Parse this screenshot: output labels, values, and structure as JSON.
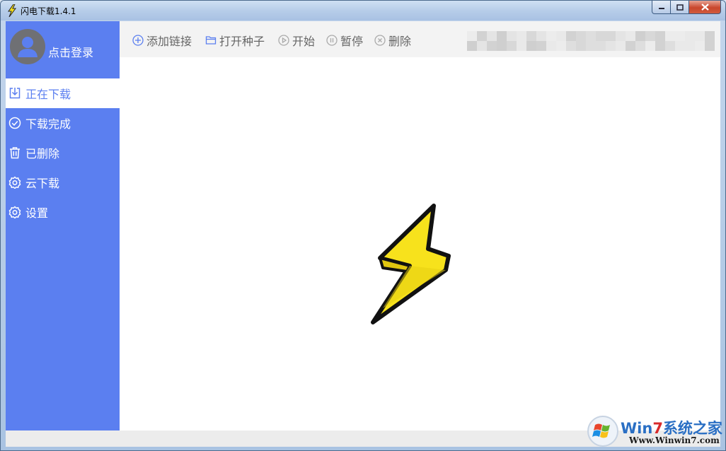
{
  "window": {
    "title": "闪电下载1.4.1",
    "icon": "lightning-bolt-icon",
    "controls": {
      "minimize": "minimize-icon",
      "maximize": "maximize-icon",
      "close": "close-icon"
    }
  },
  "colors": {
    "sidebar": "#5b7ff0",
    "active_text": "#5b7ff0",
    "toolbar_bg": "#f3f3f3",
    "toolbar_text": "#666666",
    "bolt_fill": "#f7e21c",
    "bolt_outline": "#111111"
  },
  "user": {
    "login_label": "点击登录",
    "avatar_icon": "user-avatar-icon"
  },
  "sidebar": {
    "items": [
      {
        "label": "正在下载",
        "icon": "download-icon",
        "active": true
      },
      {
        "label": "下载完成",
        "icon": "check-circle-icon",
        "active": false
      },
      {
        "label": "已删除",
        "icon": "trash-icon",
        "active": false
      },
      {
        "label": "云下载",
        "icon": "gear-icon",
        "active": false
      },
      {
        "label": "设置",
        "icon": "gear-icon",
        "active": false
      }
    ]
  },
  "toolbar": {
    "add_link": "添加链接",
    "open_torrent": "打开种子",
    "start": "开始",
    "pause": "暂停",
    "delete": "删除"
  },
  "content": {
    "empty_state_icon": "lightning-bolt-logo"
  },
  "watermark": {
    "brand_a": "Win",
    "brand_b": "7",
    "brand_c": "系统之家",
    "url": "Www.Winwin7.com"
  }
}
